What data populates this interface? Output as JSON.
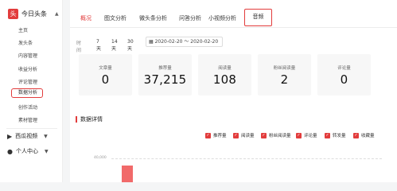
{
  "sidebar": {
    "brand": "今日头条",
    "items": [
      {
        "label": "主页"
      },
      {
        "label": "发头条"
      },
      {
        "label": "内容管理"
      },
      {
        "label": "收益分析"
      },
      {
        "label": "评论管理"
      },
      {
        "label": "数据分析",
        "active": true
      },
      {
        "label": "创作活动"
      },
      {
        "label": "素材管理"
      }
    ],
    "groups": [
      {
        "label": "西瓜视频",
        "icon": "video-icon"
      },
      {
        "label": "个人中心",
        "icon": "user-icon"
      }
    ]
  },
  "tabs": [
    {
      "label": "概况",
      "active": true
    },
    {
      "label": "图文分析"
    },
    {
      "label": "微头条分析"
    },
    {
      "label": "问答分析"
    },
    {
      "label": "小视频分析"
    },
    {
      "label": "音频",
      "highlighted": true
    }
  ],
  "time": {
    "label": "时间",
    "options": [
      "7天",
      "14天",
      "30天"
    ],
    "range": "2020-02-20 ～ 2020-02-20"
  },
  "stats": [
    {
      "label": "文章量",
      "value": "0"
    },
    {
      "label": "推荐量",
      "value": "37,215"
    },
    {
      "label": "阅读量",
      "value": "108"
    },
    {
      "label": "粉丝阅读量",
      "value": "2"
    },
    {
      "label": "评论量",
      "value": "0"
    }
  ],
  "details": {
    "title": "数据详情",
    "legend": [
      "推荐量",
      "阅读量",
      "粉丝阅读量",
      "评论量",
      "转发量",
      "收藏量"
    ],
    "y_tick": "40,000"
  },
  "colors": {
    "accent": "#e23c3c",
    "bar": "#f16a6a"
  }
}
